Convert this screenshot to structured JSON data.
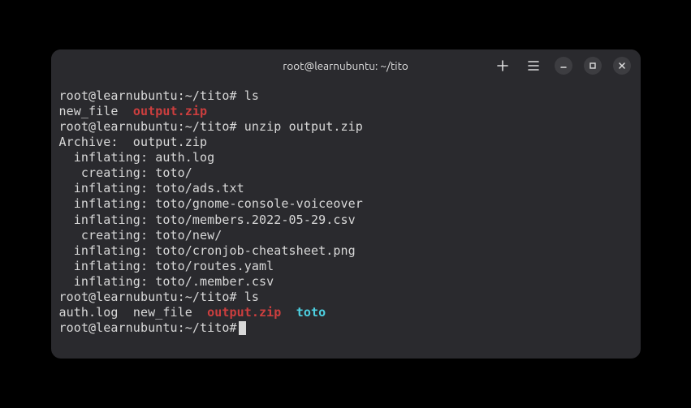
{
  "titlebar": {
    "title": "root@learnubuntu: ~/tito"
  },
  "prompt": "root@learnubuntu:~/tito#",
  "lines": {
    "l0_cmd": "ls",
    "l1_file1": "new_file",
    "l1_file2": "output.zip",
    "l2_cmd": "unzip output.zip",
    "l3": "Archive:  output.zip",
    "l4": "  inflating: auth.log",
    "l5": "   creating: toto/",
    "l6": "  inflating: toto/ads.txt",
    "l7": "  inflating: toto/gnome-console-voiceover",
    "l8": "  inflating: toto/members.2022-05-29.csv",
    "l9": "   creating: toto/new/",
    "l10": "  inflating: toto/cronjob-cheatsheet.png",
    "l11": "  inflating: toto/routes.yaml",
    "l12": "  inflating: toto/.member.csv",
    "l13_cmd": "ls",
    "l14_f1": "auth.log",
    "l14_f2": "new_file",
    "l14_f3": "output.zip",
    "l14_f4": "toto"
  }
}
